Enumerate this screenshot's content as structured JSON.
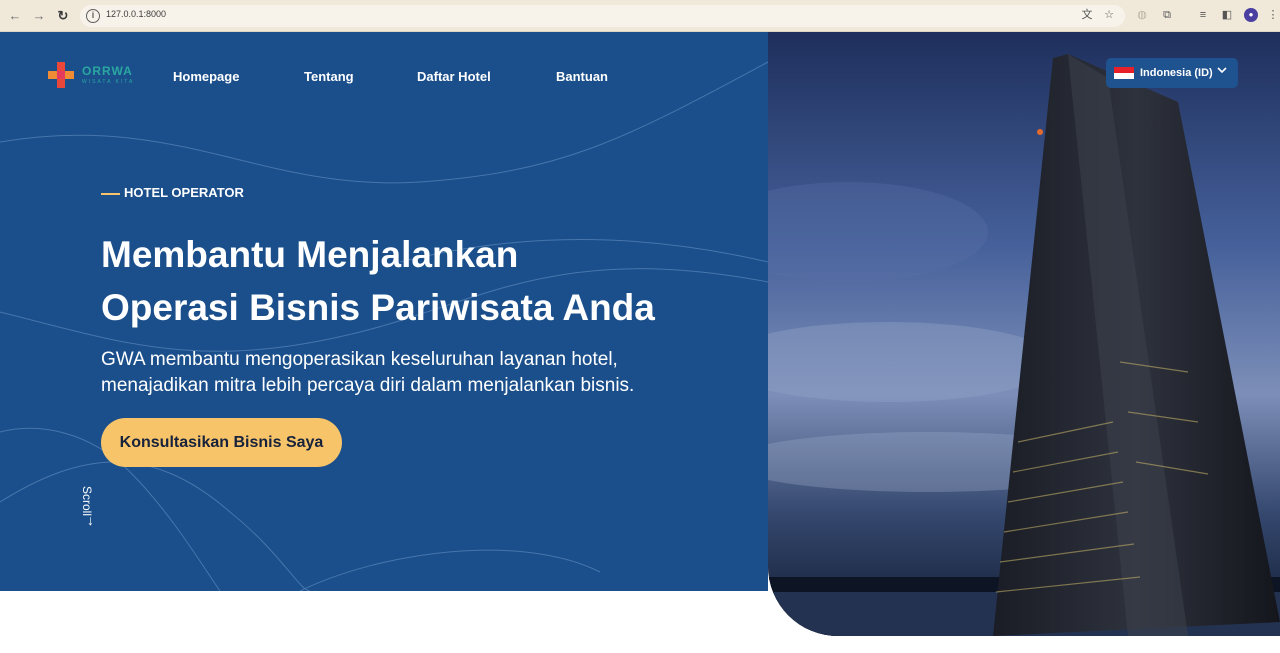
{
  "browser": {
    "url": "127.0.0.1:8000",
    "icons": [
      "back-icon",
      "forward-icon",
      "reload-icon",
      "info-icon",
      "translate-icon",
      "star-icon",
      "extension-icon",
      "puzzle-icon",
      "media-icon",
      "sidebar-icon",
      "profile-icon",
      "menu-icon"
    ]
  },
  "nav": {
    "logo_text": "ORRWA",
    "logo_sub": "WISATA KITA",
    "links": [
      "Homepage",
      "Tentang",
      "Daftar Hotel",
      "Bantuan"
    ]
  },
  "language": {
    "label": "Indonesia (ID)",
    "flag_colors": [
      "#e8202a",
      "#ffffff"
    ]
  },
  "hero": {
    "eyebrow": "HOTEL OPERATOR",
    "title_line1": "Membantu Menjalankan",
    "title_line2": "Operasi Bisnis Pariwisata Anda",
    "subtitle_line1": "GWA membantu mengoperasikan keseluruhan layanan hotel,",
    "subtitle_line2": "menajadikan mitra lebih percaya diri dalam menjalankan bisnis.",
    "cta_label": "Konsultasikan Bisnis Saya",
    "scroll_label": "Scroll",
    "scroll_arrow": "→"
  },
  "colors": {
    "hero_bg": "#1a4f8b",
    "accent": "#f7c46a",
    "text": "#ffffff"
  }
}
